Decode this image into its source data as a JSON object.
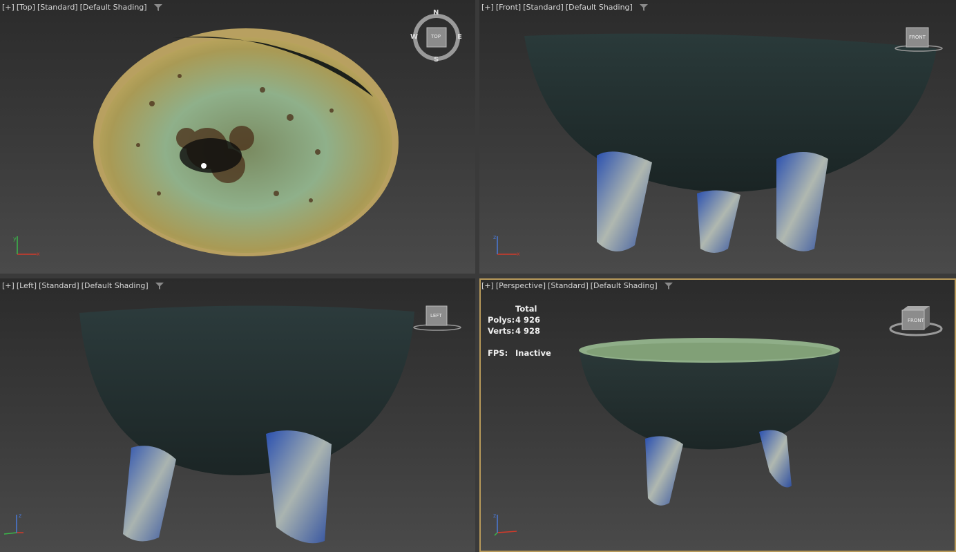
{
  "viewports": {
    "top": {
      "plus": "[+]",
      "view": "[Top]",
      "preset": "[Standard]",
      "shading": "[Default Shading]",
      "compass": {
        "n": "N",
        "s": "S",
        "e": "E",
        "w": "W",
        "cube": "TOP"
      }
    },
    "front": {
      "plus": "[+]",
      "view": "[Front]",
      "preset": "[Standard]",
      "shading": "[Default Shading]",
      "cube": "FRONT"
    },
    "left": {
      "plus": "[+]",
      "view": "[Left]",
      "preset": "[Standard]",
      "shading": "[Default Shading]",
      "cube": "LEFT"
    },
    "perspective": {
      "plus": "[+]",
      "view": "[Perspective]",
      "preset": "[Standard]",
      "shading": "[Default Shading]",
      "cube": "FRONT",
      "stats": {
        "total_label": "Total",
        "polys_label": "Polys:",
        "polys_value": "4 926",
        "verts_label": "Verts:",
        "verts_value": "4 928",
        "fps_label": "FPS:",
        "fps_value": "Inactive"
      }
    }
  },
  "axes": {
    "x": "x",
    "y": "y",
    "z": "z"
  },
  "colors": {
    "active_border": "#b89a5a",
    "bg_top": "#2b2b2b",
    "bg_bottom": "#4a4a4a",
    "axis_x": "#d23a2a",
    "axis_y": "#3ab84a",
    "axis_z": "#4a7ad8"
  }
}
